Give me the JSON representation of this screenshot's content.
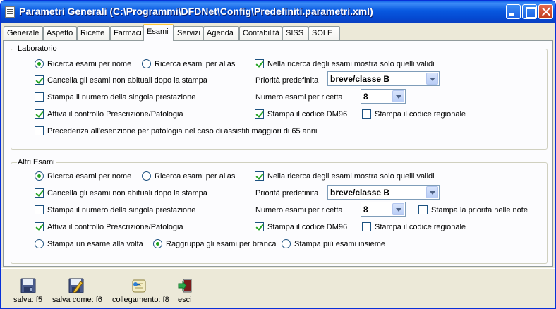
{
  "window": {
    "title": "Parametri Generali (C:\\Programmi\\DFDNet\\Config\\Predefiniti.parametri.xml)"
  },
  "tabs": [
    "Generale",
    "Aspetto",
    "Ricette",
    "Farmaci",
    "Esami",
    "Servizi",
    "Agenda",
    "Contabilità",
    "SISS",
    "SOLE"
  ],
  "active_tab": "Esami",
  "lab": {
    "legend": "Laboratorio",
    "radio_nome": "Ricerca esami per nome",
    "radio_alias": "Ricerca esami per alias",
    "validi": "Nella ricerca degli esami mostra solo quelli validi",
    "cancella": "Cancella gli esami non abituali dopo la stampa",
    "priorita_label": "Priorità predefinita",
    "priorita_value": "breve/classe B",
    "stampa_numero": "Stampa il numero della singola prestazione",
    "numero_label": "Numero esami per ricetta",
    "numero_value": "8",
    "attiva": "Attiva il controllo Prescrizione/Patologia",
    "dm96": "Stampa il codice DM96",
    "regionale": "Stampa il codice regionale",
    "precedenza": "Precedenza all'esenzione per patologia nel caso di assistiti maggiori di 65 anni"
  },
  "altri": {
    "legend": "Altri Esami",
    "radio_nome": "Ricerca esami per nome",
    "radio_alias": "Ricerca esami per alias",
    "validi": "Nella ricerca degli esami mostra solo quelli validi",
    "cancella": "Cancella gli esami non abituali dopo la stampa",
    "priorita_label": "Priorità predefinita",
    "priorita_value": "breve/classe B",
    "stampa_numero": "Stampa il numero della singola prestazione",
    "numero_label": "Numero esami per ricetta",
    "numero_value": "8",
    "priorita_note": "Stampa la priorità nelle note",
    "attiva": "Attiva il controllo Prescrizione/Patologia",
    "dm96": "Stampa il codice DM96",
    "regionale": "Stampa il codice regionale",
    "uno": "Stampa un esame alla volta",
    "raggruppa": "Raggruppa gli esami per branca",
    "insieme": "Stampa più esami insieme"
  },
  "toolbar": {
    "salva": "salva: f5",
    "salva_come": "salva come: f6",
    "collegamento": "collegamento: f8",
    "esci": "esci"
  },
  "icons": {
    "save": "floppy-disk-icon",
    "save_as": "floppy-pencil-icon",
    "link": "scroll-link-icon",
    "exit": "exit-door-icon"
  }
}
